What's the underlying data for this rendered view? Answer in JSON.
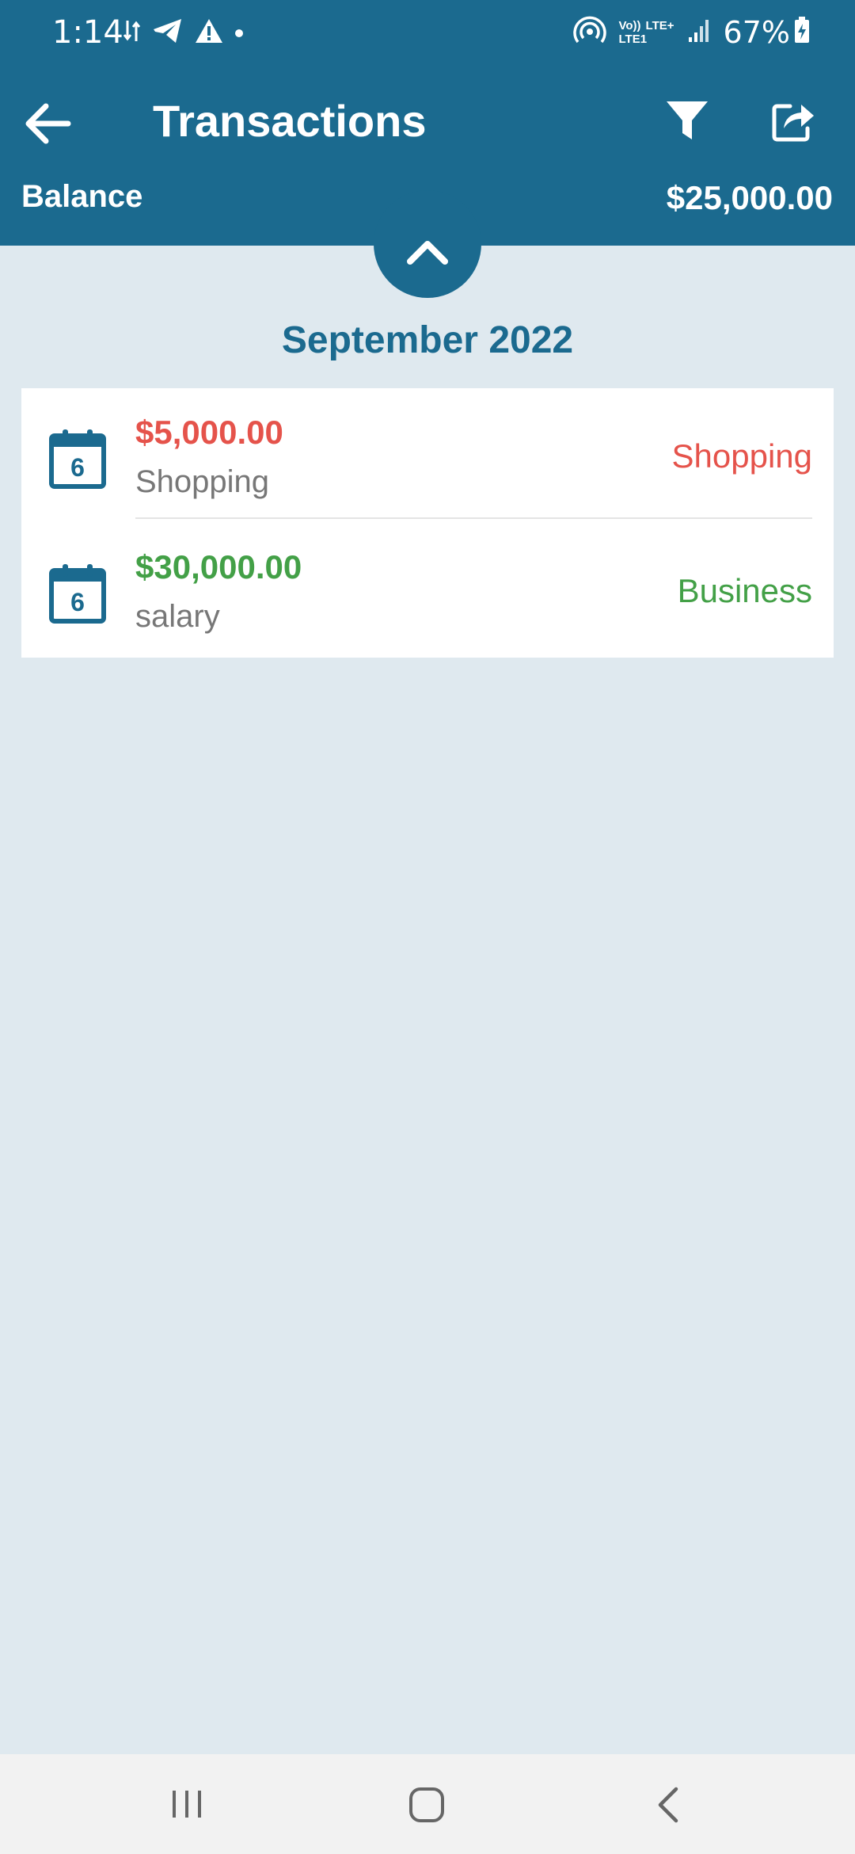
{
  "status_bar": {
    "time": "1:14",
    "battery": "67%",
    "network_top": "LTE+",
    "network_voice": "Vo))",
    "network_sim": "LTE1"
  },
  "app_bar": {
    "title": "Transactions",
    "balance_label": "Balance",
    "balance_value": "$25,000.00"
  },
  "section": {
    "month": "September 2022"
  },
  "transactions": [
    {
      "day": "6",
      "amount": "$5,000.00",
      "note": "Shopping",
      "category": "Shopping",
      "type": "expense"
    },
    {
      "day": "6",
      "amount": "$30,000.00",
      "note": "salary",
      "category": "Business",
      "type": "income"
    }
  ],
  "colors": {
    "primary": "#1b6a8f",
    "background": "#dfe9ef",
    "expense": "#e5534b",
    "income": "#43a047"
  },
  "icons": [
    "back-arrow-icon",
    "filter-icon",
    "share-icon",
    "chevron-up-icon",
    "calendar-icon",
    "recents-icon",
    "home-icon",
    "nav-back-icon"
  ]
}
